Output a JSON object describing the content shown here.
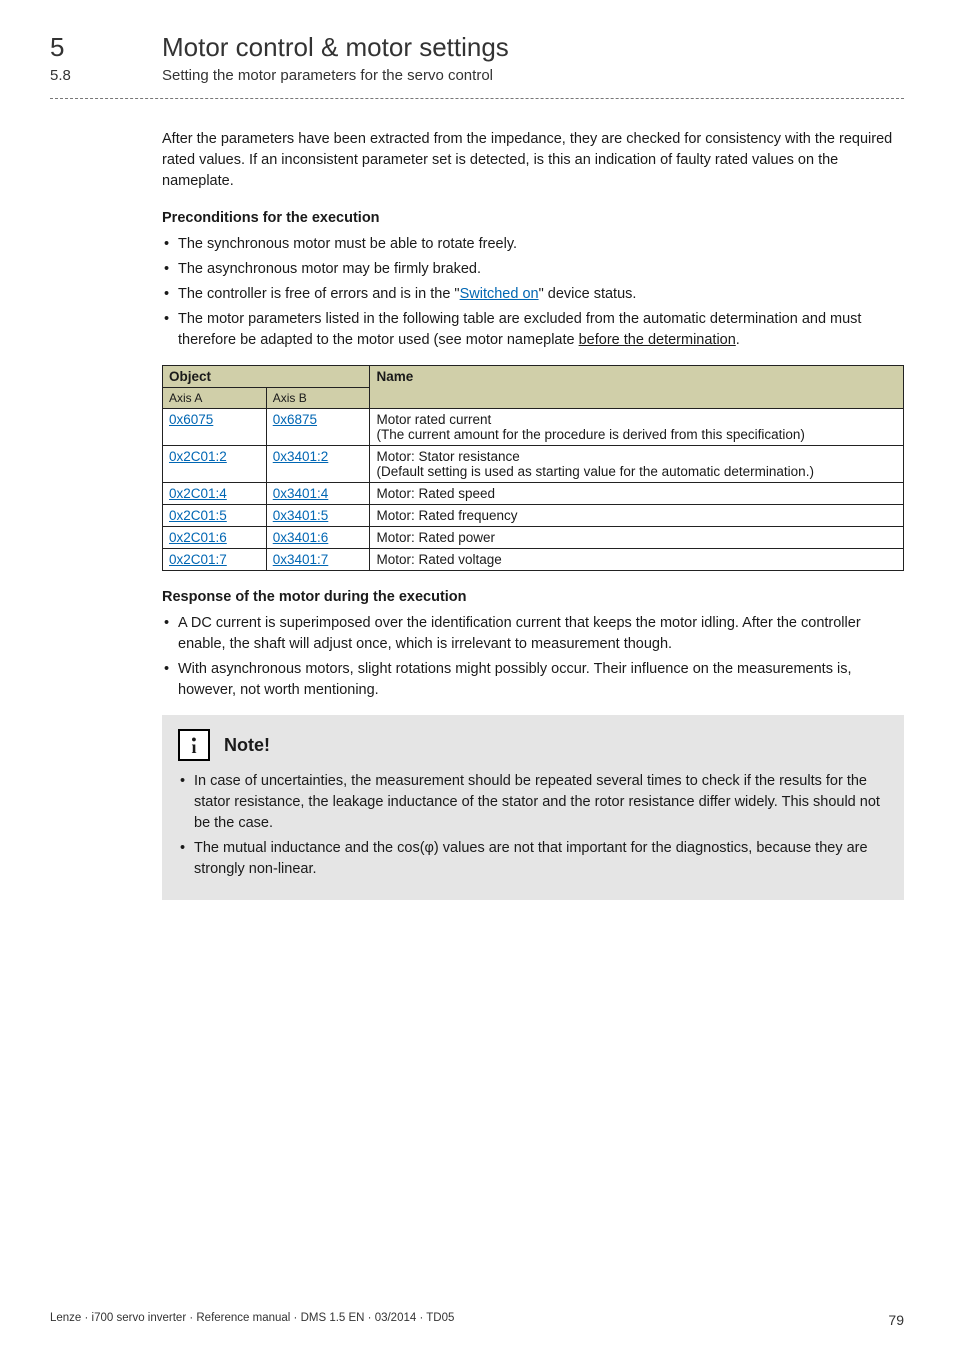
{
  "header": {
    "chapter_num": "5",
    "chapter_title": "Motor control & motor settings",
    "section_num": "5.8",
    "section_title": "Setting the motor parameters for the servo control"
  },
  "intro_para": "After the parameters have been extracted from the impedance, they are checked for consistency with the required rated values. If an inconsistent parameter set is detected, is this an indication of faulty rated values on the nameplate.",
  "preconditions": {
    "heading": "Preconditions for the execution",
    "items": {
      "b0": "The synchronous motor must be able to rotate freely.",
      "b1": "The asynchronous motor may be firmly braked.",
      "b2_pre": "The controller is free of errors and is in the \"",
      "b2_link": "Switched on",
      "b2_post": "\" device status.",
      "b3_pre": "The motor parameters listed in the following table are excluded from the automatic determination and must therefore be adapted to the motor used (see motor nameplate ",
      "b3_uline": "before the determination",
      "b3_post": "."
    }
  },
  "table": {
    "head_object": "Object",
    "head_name": "Name",
    "head_axis_a": "Axis A",
    "head_axis_b": "Axis B",
    "rows": [
      {
        "a": "0x6075",
        "b": "0x6875",
        "name_l1": "Motor rated current",
        "name_l2": "(The current amount for the procedure is derived from this specification)"
      },
      {
        "a": "0x2C01:2",
        "b": "0x3401:2",
        "name_l1": "Motor: Stator resistance",
        "name_l2": "(Default setting is used as starting value for the automatic determination.)"
      },
      {
        "a": "0x2C01:4",
        "b": "0x3401:4",
        "name_l1": "Motor: Rated speed",
        "name_l2": ""
      },
      {
        "a": "0x2C01:5",
        "b": "0x3401:5",
        "name_l1": "Motor: Rated frequency",
        "name_l2": ""
      },
      {
        "a": "0x2C01:6",
        "b": "0x3401:6",
        "name_l1": "Motor: Rated power",
        "name_l2": ""
      },
      {
        "a": "0x2C01:7",
        "b": "0x3401:7",
        "name_l1": "Motor: Rated voltage",
        "name_l2": ""
      }
    ]
  },
  "response": {
    "heading": "Response of the motor during the execution",
    "items": {
      "b0": "A DC current is superimposed over the identification current that keeps the motor idling. After the controller enable, the shaft will adjust once, which is irrelevant to measurement though.",
      "b1": "With asynchronous motors, slight rotations might possibly occur. Their influence on the measurements is, however, not worth mentioning."
    }
  },
  "note": {
    "icon_char": "i",
    "title": "Note!",
    "items": {
      "b0": "In case of uncertainties, the measurement should be repeated several times to check if the results for the stator resistance, the leakage inductance of the stator and the rotor resistance differ widely. This should not be the case.",
      "b1": "The mutual inductance and the cos(φ) values are not that important for the diagnostics, because they are strongly non-linear."
    }
  },
  "footer": {
    "left": "Lenze · i700 servo inverter · Reference manual · DMS 1.5 EN · 03/2014 · TD05",
    "page": "79"
  }
}
